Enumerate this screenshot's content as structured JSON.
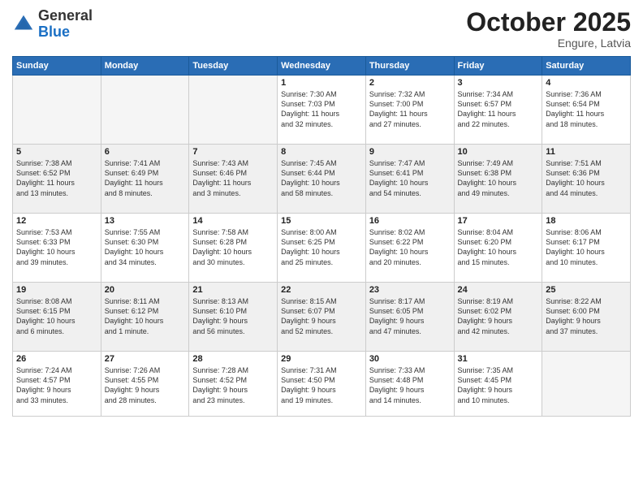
{
  "header": {
    "logo_general": "General",
    "logo_blue": "Blue",
    "month_title": "October 2025",
    "location": "Engure, Latvia"
  },
  "days_of_week": [
    "Sunday",
    "Monday",
    "Tuesday",
    "Wednesday",
    "Thursday",
    "Friday",
    "Saturday"
  ],
  "weeks": [
    [
      {
        "day": "",
        "info": ""
      },
      {
        "day": "",
        "info": ""
      },
      {
        "day": "",
        "info": ""
      },
      {
        "day": "1",
        "info": "Sunrise: 7:30 AM\nSunset: 7:03 PM\nDaylight: 11 hours\nand 32 minutes."
      },
      {
        "day": "2",
        "info": "Sunrise: 7:32 AM\nSunset: 7:00 PM\nDaylight: 11 hours\nand 27 minutes."
      },
      {
        "day": "3",
        "info": "Sunrise: 7:34 AM\nSunset: 6:57 PM\nDaylight: 11 hours\nand 22 minutes."
      },
      {
        "day": "4",
        "info": "Sunrise: 7:36 AM\nSunset: 6:54 PM\nDaylight: 11 hours\nand 18 minutes."
      }
    ],
    [
      {
        "day": "5",
        "info": "Sunrise: 7:38 AM\nSunset: 6:52 PM\nDaylight: 11 hours\nand 13 minutes."
      },
      {
        "day": "6",
        "info": "Sunrise: 7:41 AM\nSunset: 6:49 PM\nDaylight: 11 hours\nand 8 minutes."
      },
      {
        "day": "7",
        "info": "Sunrise: 7:43 AM\nSunset: 6:46 PM\nDaylight: 11 hours\nand 3 minutes."
      },
      {
        "day": "8",
        "info": "Sunrise: 7:45 AM\nSunset: 6:44 PM\nDaylight: 10 hours\nand 58 minutes."
      },
      {
        "day": "9",
        "info": "Sunrise: 7:47 AM\nSunset: 6:41 PM\nDaylight: 10 hours\nand 54 minutes."
      },
      {
        "day": "10",
        "info": "Sunrise: 7:49 AM\nSunset: 6:38 PM\nDaylight: 10 hours\nand 49 minutes."
      },
      {
        "day": "11",
        "info": "Sunrise: 7:51 AM\nSunset: 6:36 PM\nDaylight: 10 hours\nand 44 minutes."
      }
    ],
    [
      {
        "day": "12",
        "info": "Sunrise: 7:53 AM\nSunset: 6:33 PM\nDaylight: 10 hours\nand 39 minutes."
      },
      {
        "day": "13",
        "info": "Sunrise: 7:55 AM\nSunset: 6:30 PM\nDaylight: 10 hours\nand 34 minutes."
      },
      {
        "day": "14",
        "info": "Sunrise: 7:58 AM\nSunset: 6:28 PM\nDaylight: 10 hours\nand 30 minutes."
      },
      {
        "day": "15",
        "info": "Sunrise: 8:00 AM\nSunset: 6:25 PM\nDaylight: 10 hours\nand 25 minutes."
      },
      {
        "day": "16",
        "info": "Sunrise: 8:02 AM\nSunset: 6:22 PM\nDaylight: 10 hours\nand 20 minutes."
      },
      {
        "day": "17",
        "info": "Sunrise: 8:04 AM\nSunset: 6:20 PM\nDaylight: 10 hours\nand 15 minutes."
      },
      {
        "day": "18",
        "info": "Sunrise: 8:06 AM\nSunset: 6:17 PM\nDaylight: 10 hours\nand 10 minutes."
      }
    ],
    [
      {
        "day": "19",
        "info": "Sunrise: 8:08 AM\nSunset: 6:15 PM\nDaylight: 10 hours\nand 6 minutes."
      },
      {
        "day": "20",
        "info": "Sunrise: 8:11 AM\nSunset: 6:12 PM\nDaylight: 10 hours\nand 1 minute."
      },
      {
        "day": "21",
        "info": "Sunrise: 8:13 AM\nSunset: 6:10 PM\nDaylight: 9 hours\nand 56 minutes."
      },
      {
        "day": "22",
        "info": "Sunrise: 8:15 AM\nSunset: 6:07 PM\nDaylight: 9 hours\nand 52 minutes."
      },
      {
        "day": "23",
        "info": "Sunrise: 8:17 AM\nSunset: 6:05 PM\nDaylight: 9 hours\nand 47 minutes."
      },
      {
        "day": "24",
        "info": "Sunrise: 8:19 AM\nSunset: 6:02 PM\nDaylight: 9 hours\nand 42 minutes."
      },
      {
        "day": "25",
        "info": "Sunrise: 8:22 AM\nSunset: 6:00 PM\nDaylight: 9 hours\nand 37 minutes."
      }
    ],
    [
      {
        "day": "26",
        "info": "Sunrise: 7:24 AM\nSunset: 4:57 PM\nDaylight: 9 hours\nand 33 minutes."
      },
      {
        "day": "27",
        "info": "Sunrise: 7:26 AM\nSunset: 4:55 PM\nDaylight: 9 hours\nand 28 minutes."
      },
      {
        "day": "28",
        "info": "Sunrise: 7:28 AM\nSunset: 4:52 PM\nDaylight: 9 hours\nand 23 minutes."
      },
      {
        "day": "29",
        "info": "Sunrise: 7:31 AM\nSunset: 4:50 PM\nDaylight: 9 hours\nand 19 minutes."
      },
      {
        "day": "30",
        "info": "Sunrise: 7:33 AM\nSunset: 4:48 PM\nDaylight: 9 hours\nand 14 minutes."
      },
      {
        "day": "31",
        "info": "Sunrise: 7:35 AM\nSunset: 4:45 PM\nDaylight: 9 hours\nand 10 minutes."
      },
      {
        "day": "",
        "info": ""
      }
    ]
  ]
}
